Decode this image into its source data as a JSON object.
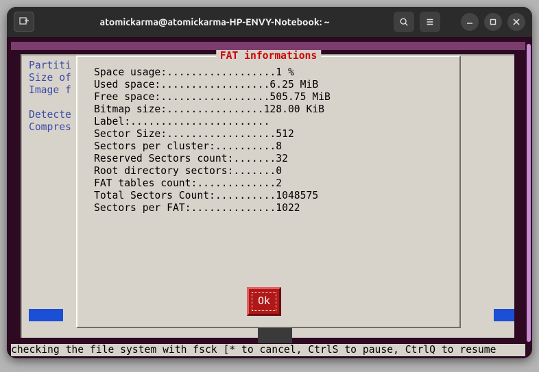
{
  "window": {
    "title": "atomickarma@atomickarma-HP-ENVY-Notebook: ~"
  },
  "side": {
    "block1": "Partiti\nSize of\nImage f",
    "block2": "Detecte\nCompres"
  },
  "dialog": {
    "title": " FAT informations ",
    "rows": [
      {
        "label": "Space usage:",
        "dots": "..................",
        "value": "1 %"
      },
      {
        "label": "Used space:",
        "dots": "..................",
        "value": "6.25 MiB"
      },
      {
        "label": "Free space:",
        "dots": "..................",
        "value": "505.75 MiB"
      },
      {
        "label": "Bitmap size:",
        "dots": "................",
        "value": "128.00 KiB"
      },
      {
        "label": "Label:",
        "dots": ".......................",
        "value": ""
      },
      {
        "label": "Sector Size:",
        "dots": "..................",
        "value": "512"
      },
      {
        "label": "Sectors per cluster:",
        "dots": "..........",
        "value": "8"
      },
      {
        "label": "Reserved Sectors count:",
        "dots": ".......",
        "value": "32"
      },
      {
        "label": "Root directory sectors:",
        "dots": ".......",
        "value": "0"
      },
      {
        "label": "FAT tables count:",
        "dots": ".............",
        "value": "2"
      },
      {
        "label": "Total Sectors Count:",
        "dots": "..........",
        "value": "1048575"
      },
      {
        "label": "Sectors per FAT:",
        "dots": "..............",
        "value": "1022"
      }
    ],
    "ok_label": "Ok"
  },
  "status": "checking the file system with fsck [* to cancel, CtrlS to pause, CtrlQ to resume"
}
